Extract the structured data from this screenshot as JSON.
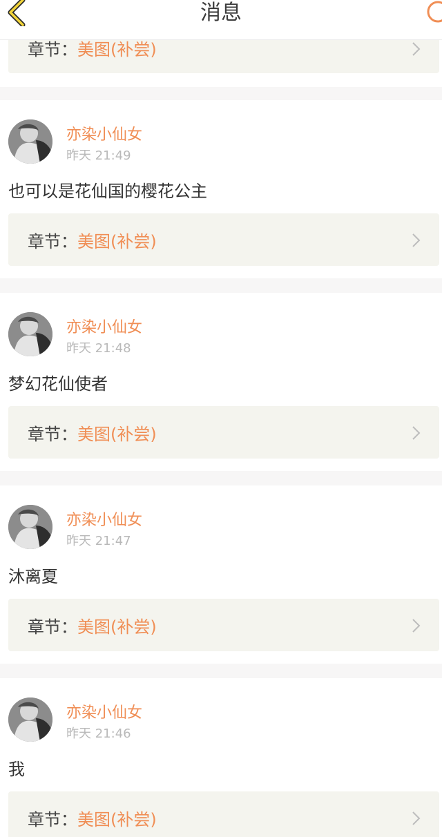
{
  "header": {
    "title": "消息",
    "back_icon": "chevron-left-icon",
    "refresh_icon": "circle-icon",
    "accent": "#f2b232"
  },
  "colors": {
    "accent_orange": "#f08e55",
    "chapter_bg": "#f4f4ee"
  },
  "top_card": {
    "chapter_label": "章节：",
    "chapter_title": "美图(补尝)"
  },
  "messages": [
    {
      "username": "亦染小仙女",
      "time": "昨天 21:49",
      "content": "也可以是花仙国的樱花公主",
      "chapter_label": "章节：",
      "chapter_title": "美图(补尝)"
    },
    {
      "username": "亦染小仙女",
      "time": "昨天 21:48",
      "content": "梦幻花仙使者",
      "chapter_label": "章节：",
      "chapter_title": "美图(补尝)"
    },
    {
      "username": "亦染小仙女",
      "time": "昨天 21:47",
      "content": "沐离夏",
      "chapter_label": "章节：",
      "chapter_title": "美图(补尝)"
    },
    {
      "username": "亦染小仙女",
      "time": "昨天 21:46",
      "content": "我",
      "chapter_label": "章节：",
      "chapter_title": "美图(补尝)"
    }
  ]
}
